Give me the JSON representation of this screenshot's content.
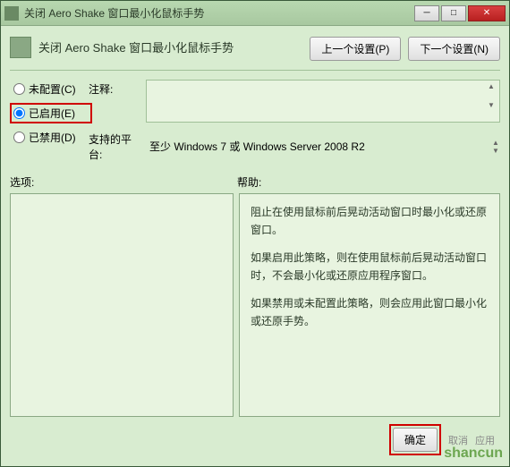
{
  "window": {
    "title": "关闭 Aero Shake 窗口最小化鼠标手势"
  },
  "header": {
    "title": "关闭 Aero Shake 窗口最小化鼠标手势",
    "prev_button": "上一个设置(P)",
    "next_button": "下一个设置(N)"
  },
  "radios": {
    "not_configured": "未配置(C)",
    "enabled": "已启用(E)",
    "disabled": "已禁用(D)",
    "selected": "enabled"
  },
  "fields": {
    "comment_label": "注释:",
    "comment_value": "",
    "platform_label": "支持的平台:",
    "platform_value": "至少 Windows 7 或 Windows Server 2008 R2"
  },
  "labels": {
    "options": "选项:",
    "help": "帮助:"
  },
  "help": {
    "p1": "阻止在使用鼠标前后晃动活动窗口时最小化或还原窗口。",
    "p2": "如果启用此策略，则在使用鼠标前后晃动活动窗口时，不会最小化或还原应用程序窗口。",
    "p3": "如果禁用或未配置此策略，则会应用此窗口最小化或还原手势。"
  },
  "footer": {
    "ok": "确定",
    "cancel": "取消",
    "apply": "应用"
  },
  "watermark": "shancun"
}
